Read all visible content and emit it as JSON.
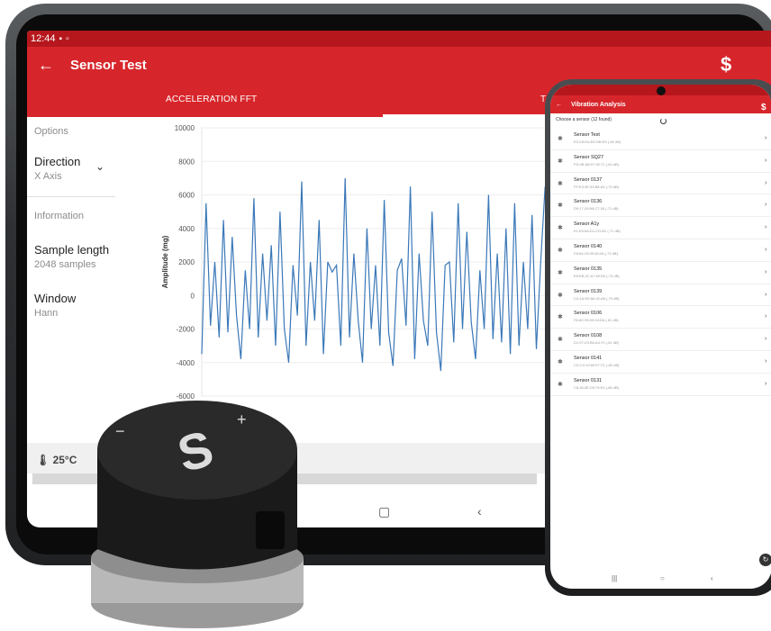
{
  "tablet": {
    "status": {
      "time": "12:44"
    },
    "appbar": {
      "title": "Sensor Test",
      "back_icon": "arrow-left-icon",
      "brand_icon": "s-logo-icon"
    },
    "tabs": [
      {
        "label": "ACCELERATION FFT"
      },
      {
        "label": "T"
      }
    ],
    "sidebar": {
      "options_heading": "Options",
      "direction_label": "Direction",
      "direction_value": "X Axis",
      "information_heading": "Information",
      "sample_length_label": "Sample length",
      "sample_length_value": "2048 samples",
      "window_label": "Window",
      "window_value": "Hann"
    },
    "bottombar": {
      "temperature": "25°C"
    },
    "nav": {
      "home": "▢",
      "back": "‹"
    }
  },
  "chart_data": {
    "type": "line",
    "ylabel": "Amplitude (mg)",
    "ylim": [
      -6000,
      10000
    ],
    "yticks": [
      "10000",
      "8000",
      "6000",
      "4000",
      "2000",
      "0",
      "-2000",
      "-4000",
      "-6000"
    ],
    "series": [
      {
        "color": "#3a78b8",
        "values": [
          -3500,
          5500,
          -1800,
          2000,
          -2500,
          4500,
          -2200,
          3500,
          -1200,
          -3800,
          1500,
          -2000,
          5800,
          -2500,
          2500,
          -1500,
          3000,
          -3000,
          5000,
          -2000,
          -4000,
          1800,
          -1200,
          6800,
          -3000,
          2000,
          -1500,
          4500,
          -3500,
          2000,
          1400,
          1800,
          -3000,
          7000,
          -2500,
          2500,
          -1500,
          -4000,
          4000,
          -2000,
          1800,
          -3000,
          5700,
          -2200,
          -4200,
          1500,
          2200,
          -1800,
          6500,
          -3800,
          2500,
          -1500,
          -3000,
          5000,
          -2200,
          -4500,
          1800,
          2000,
          -2800,
          5500,
          -2000,
          3800,
          -1600,
          -3800,
          1500,
          -2000,
          6000,
          -2600,
          2500,
          -2800,
          4000,
          -3500,
          5500,
          -3000,
          2000,
          -2000,
          4800,
          -3200,
          2000,
          6500,
          -2600
        ]
      }
    ]
  },
  "phone": {
    "appbar": {
      "title": "Vibration Analysis",
      "back_icon": "arrow-left-icon"
    },
    "choose": "Choose a sensor (12 found)",
    "sensors": [
      {
        "name": "Sensor Test",
        "mac": "E3:C8:EA:EE:DB:E5 (-60 dB)"
      },
      {
        "name": "Sensor SQ27",
        "mac": "FD:2B:AB:97:30:72 (-64 dB)"
      },
      {
        "name": "Sensor 0137",
        "mac": "FF:E3:3E:93:B8:A3 (-70 dB)"
      },
      {
        "name": "Sensor 0136",
        "mac": "D9:17:20:B5:C7:26 (-71 dB)"
      },
      {
        "name": "Sensor A1y",
        "mac": "E1:E5:6A:D1:CD:5D (-71 dB)"
      },
      {
        "name": "Sensor 0140",
        "mac": "F8:64:C8:39:38:2A (-73 dB)"
      },
      {
        "name": "Sensor 0135",
        "mac": "E6:EB:2C:A7:60:B3 (-74 dB)"
      },
      {
        "name": "Sensor 0139",
        "mac": "C4:1A:9D:8A:42:A8 (-79 dB)"
      },
      {
        "name": "Sensor 0106",
        "mac": "FA:8C:99:20:04:D6 (-81 dB)"
      },
      {
        "name": "Sensor 0108",
        "mac": "D1:07:C0:B0:A4:70 (-81 dB)"
      },
      {
        "name": "Sensor 0141",
        "mac": "CD:C3:10:69:57:7C (-82 dB)"
      },
      {
        "name": "Sensor 0131",
        "mac": "C5:36:4E:C8:79:E4 (-86 dB)"
      }
    ],
    "nav": {
      "recents": "|||",
      "home": "○",
      "back": "‹"
    },
    "refresh_icon": "refresh-icon"
  }
}
